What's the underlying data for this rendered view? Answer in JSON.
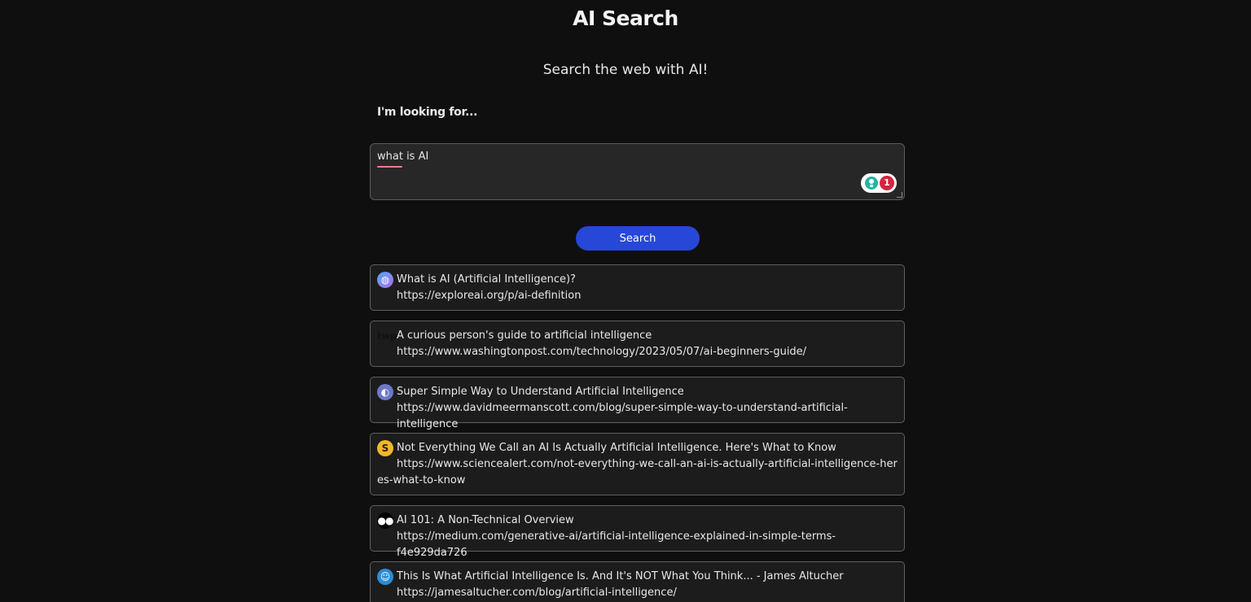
{
  "header": {
    "title": "AI Search",
    "subtitle": "Search the web with AI!"
  },
  "query": {
    "label": "I'm looking for...",
    "value": "what is AI",
    "extension_count": "1"
  },
  "search_button": {
    "label": "Search"
  },
  "results": [
    {
      "title": "What is AI (Artificial Intelligence)?",
      "url": "https://exploreai.org/p/ai-definition",
      "favicon": "globe-icon"
    },
    {
      "title": "A curious person's guide to artificial intelligence",
      "url": "https://www.washingtonpost.com/technology/2023/05/07/ai-beginners-guide/",
      "favicon": "washington-post-icon",
      "favicon_text": "twp"
    },
    {
      "title": "Super Simple Way to Understand Artificial Intelligence",
      "url": "https://www.davidmeermanscott.com/blog/super-simple-way-to-understand-artificial-intelligence",
      "favicon": "globe-icon"
    },
    {
      "title": "Not Everything We Call an AI Is Actually Artificial Intelligence. Here's What to Know",
      "url": "https://www.sciencealert.com/not-everything-we-call-an-ai-is-actually-artificial-intelligence-heres-what-to-know",
      "favicon": "sciencealert-icon",
      "favicon_text": "S"
    },
    {
      "title": "AI 101: A Non-Technical Overview",
      "url": "https://medium.com/generative-ai/artificial-intelligence-explained-in-simple-terms-f4e929da726",
      "favicon": "medium-icon",
      "favicon_text": "●●"
    },
    {
      "title": "This Is What Artificial Intelligence Is. And It's NOT What You Think... - James Altucher",
      "url": "https://jamesaltucher.com/blog/artificial-intelligence/",
      "favicon": "avatar-icon"
    }
  ]
}
